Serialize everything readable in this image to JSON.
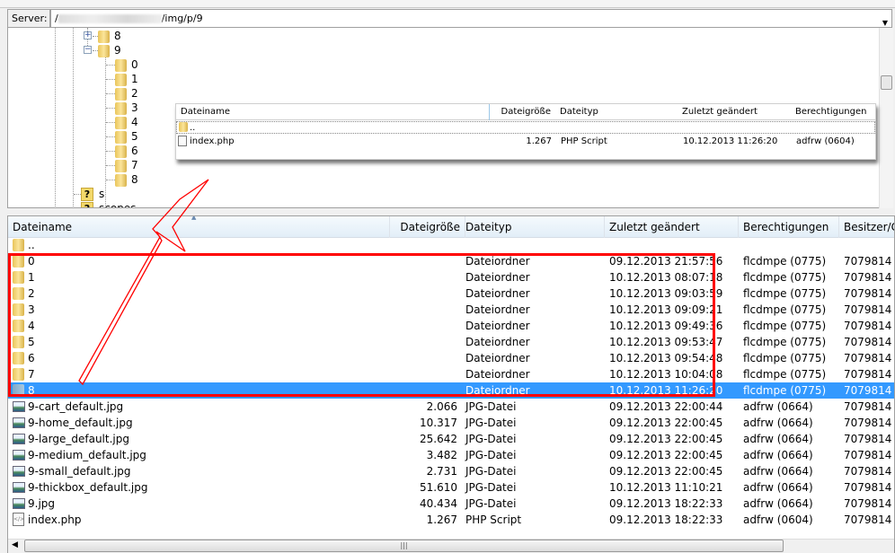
{
  "server_bar": {
    "label": "Server:",
    "path_prefix": "/",
    "path_suffix": "/img/p/9"
  },
  "tree": {
    "nodes": [
      {
        "label": "8",
        "expander": "+"
      },
      {
        "label": "9",
        "expander": "−"
      }
    ],
    "children": [
      "0",
      "1",
      "2",
      "3",
      "4",
      "5",
      "6",
      "7",
      "8"
    ],
    "unknown": [
      "s",
      "scopes"
    ]
  },
  "overlay": {
    "headers": [
      "Dateiname",
      "Dateigröße",
      "Dateityp",
      "Zuletzt geändert",
      "Berechtigungen"
    ],
    "parent": "..",
    "file": {
      "name": "index.php",
      "size": "1.267",
      "type": "PHP Script",
      "modified": "10.12.2013 11:26:20",
      "perms": "adfrw (0604)"
    }
  },
  "list": {
    "headers": [
      "Dateiname",
      "Dateigröße",
      "Dateityp",
      "Zuletzt geändert",
      "Berechtigungen",
      "Besitzer/G"
    ],
    "parent": "..",
    "rows": [
      {
        "icon": "folder",
        "name": "0",
        "size": "",
        "type": "Dateiordner",
        "modified": "09.12.2013 21:57:56",
        "perms": "flcdmpe (0775)",
        "owner": "7079814"
      },
      {
        "icon": "folder",
        "name": "1",
        "size": "",
        "type": "Dateiordner",
        "modified": "10.12.2013 08:07:18",
        "perms": "flcdmpe (0775)",
        "owner": "7079814"
      },
      {
        "icon": "folder",
        "name": "2",
        "size": "",
        "type": "Dateiordner",
        "modified": "10.12.2013 09:03:59",
        "perms": "flcdmpe (0775)",
        "owner": "7079814"
      },
      {
        "icon": "folder",
        "name": "3",
        "size": "",
        "type": "Dateiordner",
        "modified": "10.12.2013 09:09:21",
        "perms": "flcdmpe (0775)",
        "owner": "7079814"
      },
      {
        "icon": "folder",
        "name": "4",
        "size": "",
        "type": "Dateiordner",
        "modified": "10.12.2013 09:49:36",
        "perms": "flcdmpe (0775)",
        "owner": "7079814"
      },
      {
        "icon": "folder",
        "name": "5",
        "size": "",
        "type": "Dateiordner",
        "modified": "10.12.2013 09:53:47",
        "perms": "flcdmpe (0775)",
        "owner": "7079814"
      },
      {
        "icon": "folder",
        "name": "6",
        "size": "",
        "type": "Dateiordner",
        "modified": "10.12.2013 09:54:48",
        "perms": "flcdmpe (0775)",
        "owner": "7079814"
      },
      {
        "icon": "folder",
        "name": "7",
        "size": "",
        "type": "Dateiordner",
        "modified": "10.12.2013 10:04:08",
        "perms": "flcdmpe (0775)",
        "owner": "7079814"
      },
      {
        "icon": "folder",
        "name": "8",
        "size": "",
        "type": "Dateiordner",
        "modified": "10.12.2013 11:26:20",
        "perms": "flcdmpe (0775)",
        "owner": "7079814",
        "selected": true
      },
      {
        "icon": "image",
        "name": "9-cart_default.jpg",
        "size": "2.066",
        "type": "JPG-Datei",
        "modified": "09.12.2013 22:00:44",
        "perms": "adfrw (0664)",
        "owner": "7079814"
      },
      {
        "icon": "image",
        "name": "9-home_default.jpg",
        "size": "10.317",
        "type": "JPG-Datei",
        "modified": "09.12.2013 22:00:45",
        "perms": "adfrw (0664)",
        "owner": "7079814"
      },
      {
        "icon": "image",
        "name": "9-large_default.jpg",
        "size": "25.642",
        "type": "JPG-Datei",
        "modified": "09.12.2013 22:00:45",
        "perms": "adfrw (0664)",
        "owner": "7079814"
      },
      {
        "icon": "image",
        "name": "9-medium_default.jpg",
        "size": "3.482",
        "type": "JPG-Datei",
        "modified": "09.12.2013 22:00:45",
        "perms": "adfrw (0664)",
        "owner": "7079814"
      },
      {
        "icon": "image",
        "name": "9-small_default.jpg",
        "size": "2.731",
        "type": "JPG-Datei",
        "modified": "09.12.2013 22:00:45",
        "perms": "adfrw (0664)",
        "owner": "7079814"
      },
      {
        "icon": "image",
        "name": "9-thickbox_default.jpg",
        "size": "51.610",
        "type": "JPG-Datei",
        "modified": "10.12.2013 11:10:21",
        "perms": "adfrw (0664)",
        "owner": "7079814"
      },
      {
        "icon": "image",
        "name": "9.jpg",
        "size": "40.434",
        "type": "JPG-Datei",
        "modified": "09.12.2013 18:22:33",
        "perms": "adfrw (0664)",
        "owner": "7079814"
      },
      {
        "icon": "php",
        "name": "index.php",
        "size": "1.267",
        "type": "PHP Script",
        "modified": "09.12.2013 18:22:33",
        "perms": "adfrw (0604)",
        "owner": "7079814"
      }
    ]
  },
  "annotation": {
    "box_color": "#ff0000",
    "arrow_color": "#ff0000"
  }
}
